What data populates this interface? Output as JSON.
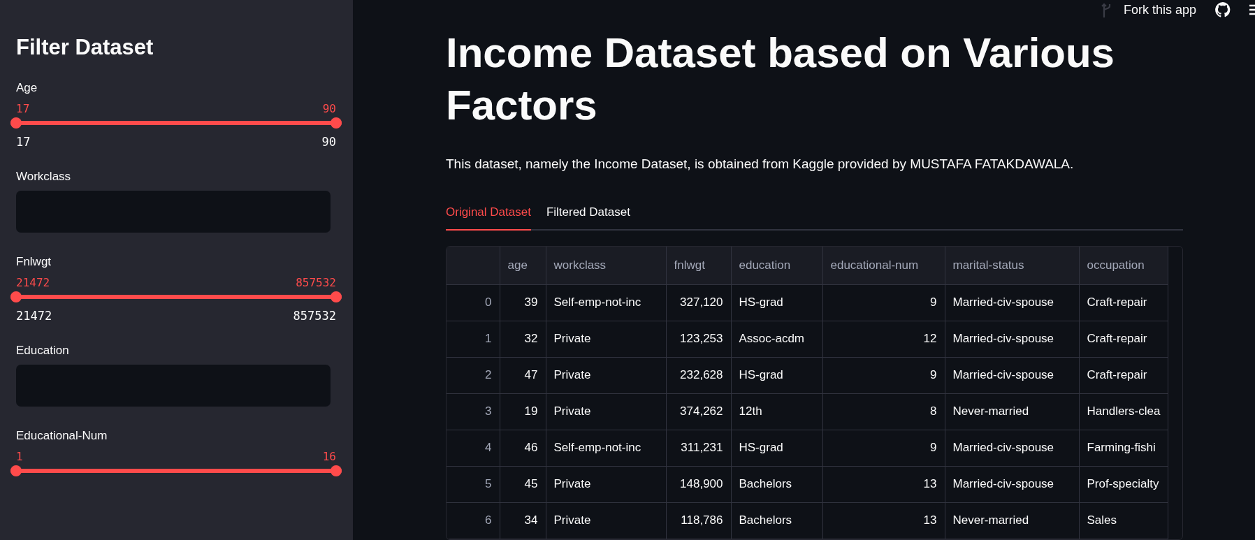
{
  "sidebar": {
    "title": "Filter Dataset",
    "filters": [
      {
        "kind": "slider",
        "label": "Age",
        "low": "17",
        "high": "90",
        "min": "17",
        "max": "90",
        "level": 1
      },
      {
        "kind": "multiselect",
        "label": "Workclass"
      },
      {
        "kind": "slider",
        "label": "Fnlwgt",
        "low": "21472",
        "high": "857532",
        "min": "21472",
        "max": "857532",
        "level": 1
      },
      {
        "kind": "multiselect",
        "label": "Education"
      },
      {
        "kind": "slider",
        "label": "Educational-Num",
        "low": "1",
        "high": "16",
        "level": 1
      }
    ]
  },
  "header": {
    "fork_label": "Fork this app"
  },
  "main": {
    "title": "Income Dataset based on Various Factors",
    "description": "This dataset, namely the Income Dataset, is obtained from Kaggle provided by MUSTAFA FATAKDAWALA.",
    "tabs": [
      {
        "label": "Original Dataset",
        "selected": true
      },
      {
        "label": "Filtered Dataset",
        "selected": false
      }
    ],
    "table": {
      "columns": [
        "",
        "age",
        "workclass",
        "fnlwgt",
        "education",
        "educational-num",
        "marital-status",
        "occupation"
      ],
      "rows": [
        [
          "0",
          "39",
          "Self-emp-not-inc",
          "327,120",
          "HS-grad",
          "9",
          "Married-civ-spouse",
          "Craft-repair"
        ],
        [
          "1",
          "32",
          "Private",
          "123,253",
          "Assoc-acdm",
          "12",
          "Married-civ-spouse",
          "Craft-repair"
        ],
        [
          "2",
          "47",
          "Private",
          "232,628",
          "HS-grad",
          "9",
          "Married-civ-spouse",
          "Craft-repair"
        ],
        [
          "3",
          "19",
          "Private",
          "374,262",
          "12th",
          "8",
          "Never-married",
          "Handlers-clea"
        ],
        [
          "4",
          "46",
          "Self-emp-not-inc",
          "311,231",
          "HS-grad",
          "9",
          "Married-civ-spouse",
          "Farming-fishi"
        ],
        [
          "5",
          "45",
          "Private",
          "148,900",
          "Bachelors",
          "13",
          "Married-civ-spouse",
          "Prof-specialty"
        ],
        [
          "6",
          "34",
          "Private",
          "118,786",
          "Bachelors",
          "13",
          "Never-married",
          "Sales"
        ]
      ]
    }
  }
}
